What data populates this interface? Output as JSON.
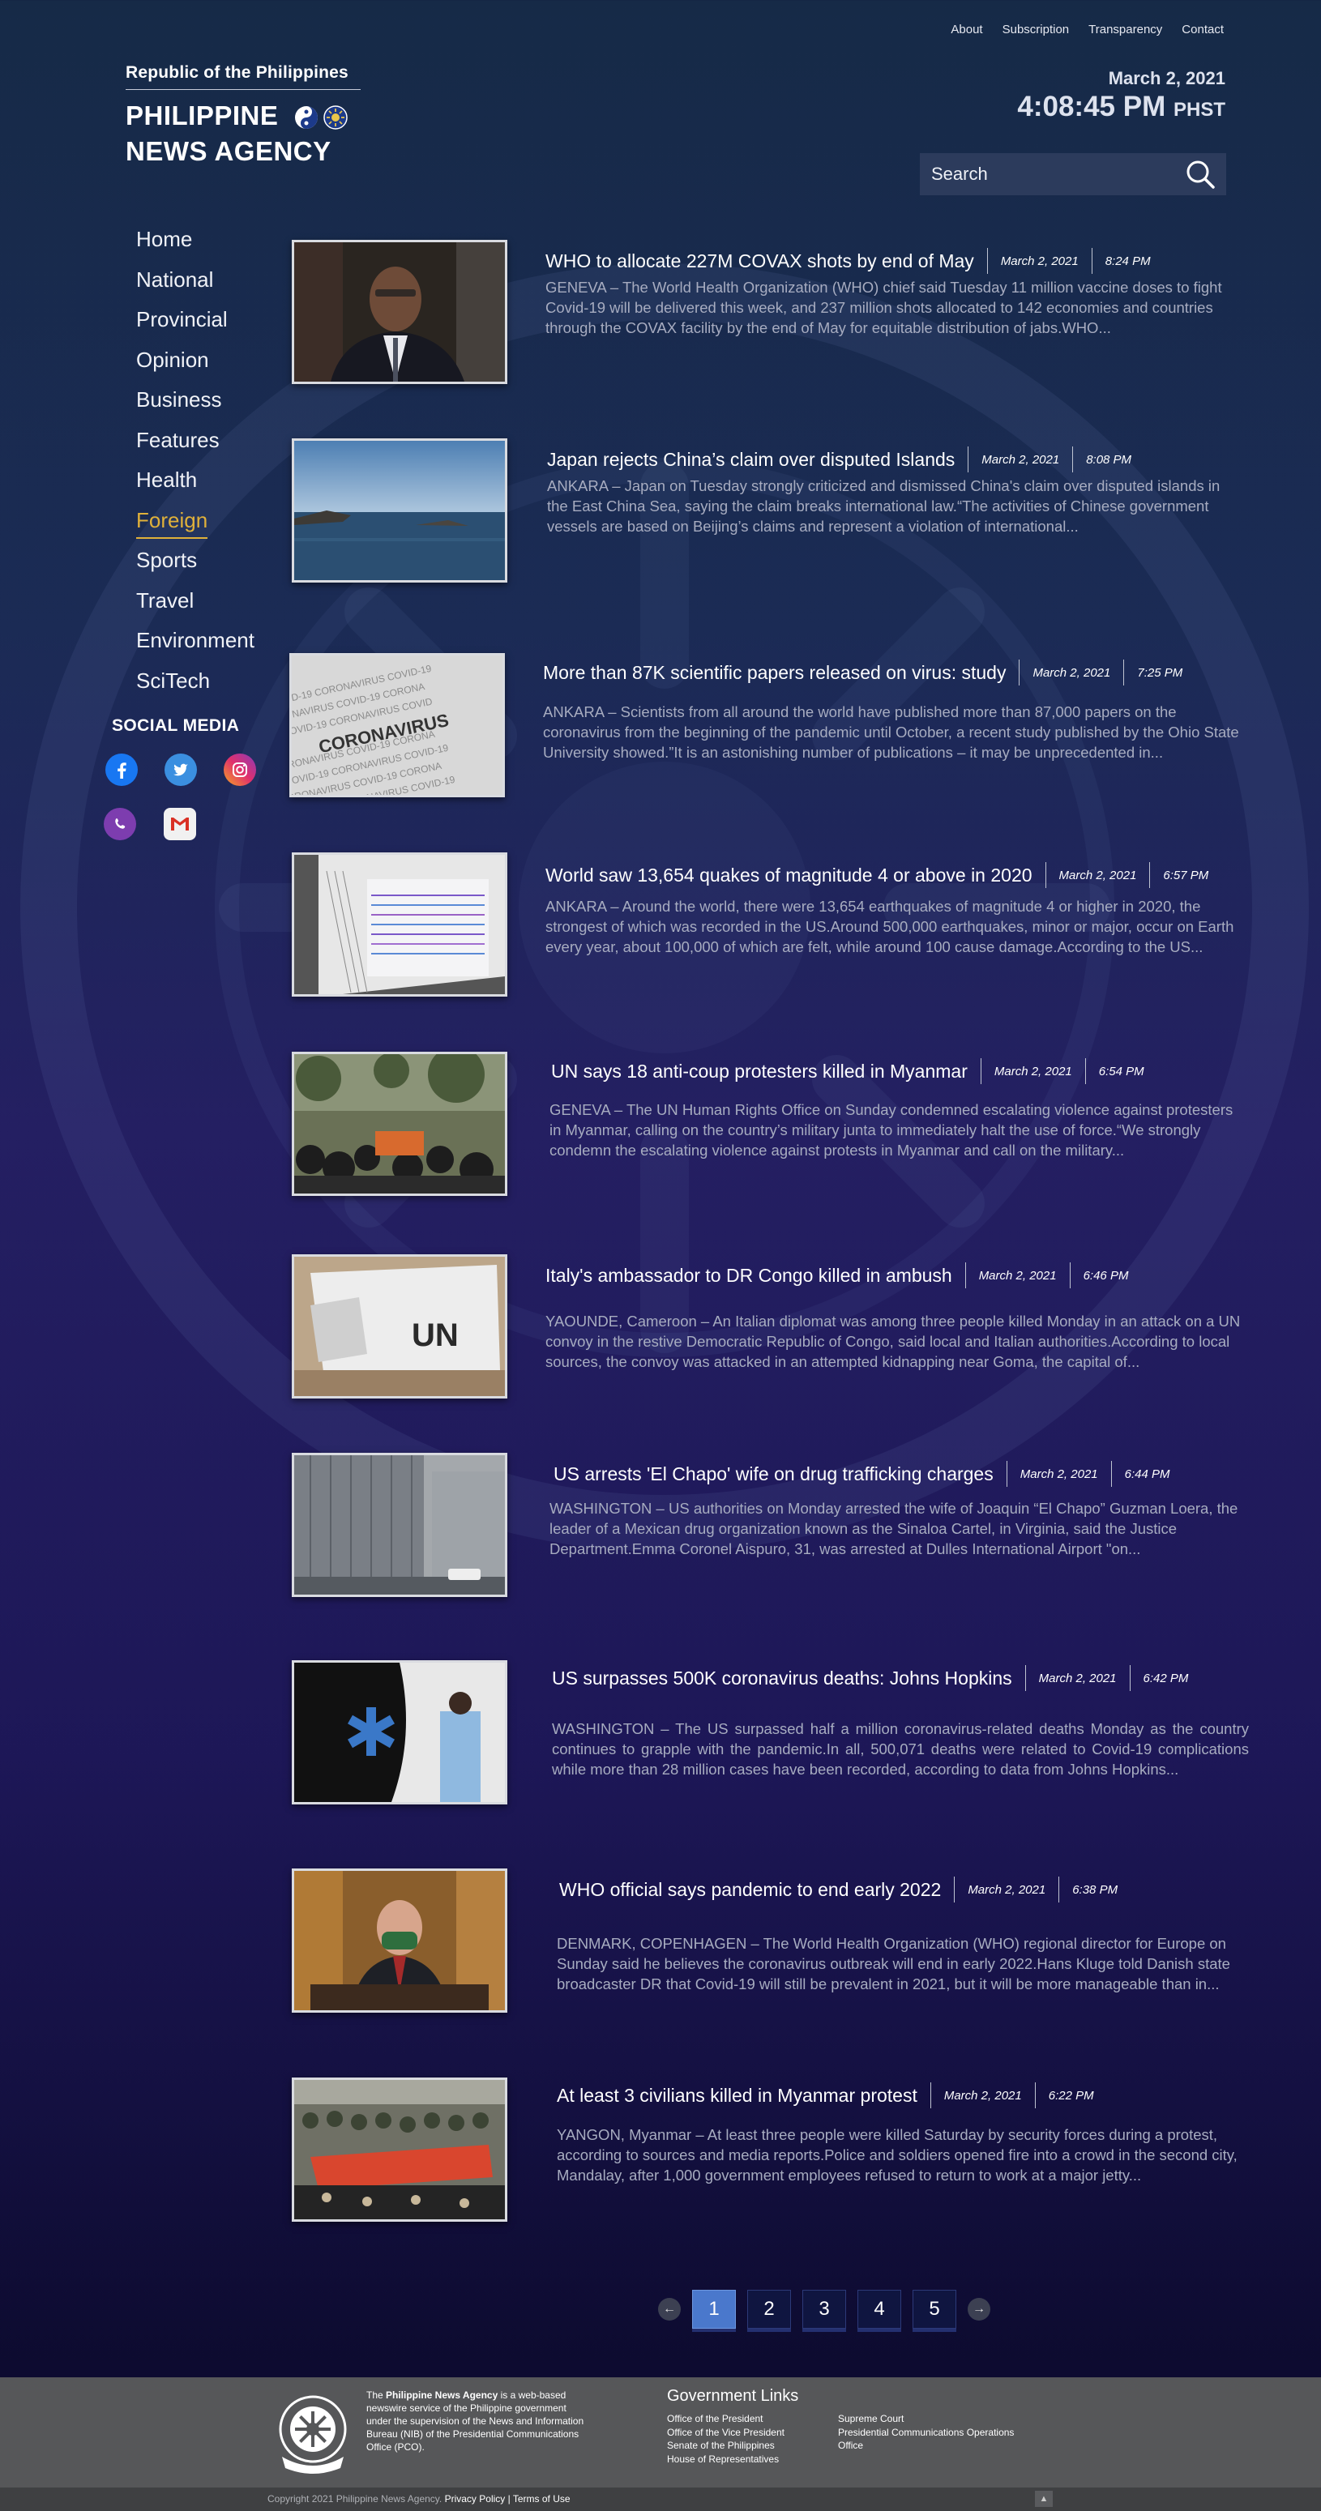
{
  "top_nav": [
    "About",
    "Subscription",
    "Transparency",
    "Contact"
  ],
  "brand": {
    "republic": "Republic of the Philippines",
    "name_line1": "PHILIPPINE",
    "name_line2": "NEWS AGENCY"
  },
  "clock": {
    "date": "March 2, 2021",
    "time": "4:08:45 PM",
    "timezone": "PHST"
  },
  "search": {
    "placeholder": "Search",
    "icon": "search-icon"
  },
  "side_nav": [
    {
      "label": "Home",
      "active": false
    },
    {
      "label": "National",
      "active": false
    },
    {
      "label": "Provincial",
      "active": false
    },
    {
      "label": "Opinion",
      "active": false
    },
    {
      "label": "Business",
      "active": false
    },
    {
      "label": "Features",
      "active": false
    },
    {
      "label": "Health",
      "active": false
    },
    {
      "label": "Foreign",
      "active": true
    },
    {
      "label": "Sports",
      "active": false
    },
    {
      "label": "Travel",
      "active": false
    },
    {
      "label": "Environment",
      "active": false
    },
    {
      "label": "SciTech",
      "active": false
    }
  ],
  "social": {
    "title": "SOCIAL MEDIA",
    "icons": [
      "facebook-icon",
      "twitter-icon",
      "instagram-icon",
      "viber-icon",
      "gmail-icon"
    ]
  },
  "articles": [
    {
      "title": "WHO to allocate 227M COVAX shots by end of May",
      "date": "March 2, 2021",
      "time": "8:24 PM",
      "excerpt": "GENEVA – The World Health Organization (WHO) chief said Tuesday 11 million vaccine doses to fight Covid-19 will be delivered this week, and 237 million shots allocated to 142 economies and countries through the COVAX facility by the end of May for equitable distribution of jabs.WHO..."
    },
    {
      "title": "Japan rejects China’s claim over disputed Islands",
      "date": "March 2, 2021",
      "time": "8:08 PM",
      "excerpt": "ANKARA – Japan on Tuesday strongly criticized and dismissed China's claim over disputed islands in the East China Sea, saying the claim breaks international law.“The activities of Chinese government vessels are based on Beijing’s claims and represent a violation of international..."
    },
    {
      "title": "More than 87K scientific papers released on virus: study",
      "date": "March 2, 2021",
      "time": "7:25 PM",
      "excerpt": "ANKARA – Scientists from all around the world have published more than 87,000 papers on the coronavirus from the beginning of the pandemic until October, a recent study published by the Ohio State University showed.”It is an astonishing number of publications – it may be unprecedented in..."
    },
    {
      "title": "World saw 13,654 quakes of magnitude 4 or above in 2020",
      "date": "March 2, 2021",
      "time": "6:57 PM",
      "excerpt": "ANKARA – Around the world, there were 13,654 earthquakes of magnitude 4 or higher in 2020, the strongest of which was recorded in the US.Around 500,000 earthquakes, minor or major, occur on Earth every year, about 100,000 of which are felt, while around 100 cause damage.According to the US..."
    },
    {
      "title": "UN says 18 anti-coup protesters killed in Myanmar",
      "date": "March 2, 2021",
      "time": "6:54 PM",
      "excerpt": "GENEVA – The UN Human Rights Office on Sunday condemned escalating violence against protesters in Myanmar, calling on the country’s military junta to immediately halt the use of force.“We strongly condemn the escalating violence against protests in Myanmar and call on the military..."
    },
    {
      "title": "Italy's ambassador to DR Congo killed in ambush",
      "date": "March 2, 2021",
      "time": "6:46 PM",
      "excerpt": "YAOUNDE, Cameroon – An Italian diplomat was among three people killed Monday in an attack on a UN convoy in the restive Democratic Republic of Congo, said local and Italian authorities.According to local sources, the convoy was attacked in an attempted kidnapping near Goma, the capital of..."
    },
    {
      "title": "US arrests 'El Chapo' wife on drug trafficking charges",
      "date": "March 2, 2021",
      "time": "6:44 PM",
      "excerpt": "WASHINGTON – US authorities on Monday arrested the wife of Joaquin “El Chapo” Guzman Loera, the leader of a Mexican drug organization known as the Sinaloa Cartel, in Virginia, said the Justice Department.Emma Coronel Aispuro, 31, was arrested at Dulles International Airport \"on..."
    },
    {
      "title": "US surpasses 500K coronavirus deaths: Johns Hopkins",
      "date": "March 2, 2021",
      "time": "6:42 PM",
      "excerpt": "WASHINGTON – The US surpassed half a million coronavirus-related deaths Monday as the country continues to grapple with the pandemic.In all, 500,071 deaths were related to Covid-19 complications while more than 28 million cases have been recorded, according to data from Johns Hopkins..."
    },
    {
      "title": "WHO official says pandemic to end early 2022",
      "date": "March 2, 2021",
      "time": "6:38 PM",
      "excerpt": "DENMARK, COPENHAGEN – The World Health Organization (WHO) regional director for Europe on Sunday said he believes the coronavirus outbreak will end in early 2022.Hans Kluge told Danish state broadcaster DR that Covid-19 will still be prevalent in 2021, but it will be more manageable than in..."
    },
    {
      "title": "At least 3 civilians killed in Myanmar protest",
      "date": "March 2, 2021",
      "time": "6:22 PM",
      "excerpt": "YANGON, Myanmar – At least three people were killed Saturday by security forces during a protest, according to sources and media reports.Police and soldiers opened fire into a crowd in the second city, Mandalay, after 1,000 government employees refused to return to work at a major jetty..."
    }
  ],
  "pagination": {
    "pages": [
      "1",
      "2",
      "3",
      "4",
      "5"
    ],
    "current": "1"
  },
  "footer": {
    "desc_prefix": "The ",
    "desc_bold": "Philippine News Agency",
    "desc_rest": " is a web-based newswire service of the Philippine government under the supervision of the News and Information Bureau (NIB) of the Presidential Communications Office (PCO).",
    "gov_title": "Government Links",
    "gov_links_col1": [
      "Office of the President",
      "Office of the Vice President",
      "Senate of the Philippines",
      "House of Representatives"
    ],
    "gov_links_col2": [
      "Supreme Court",
      "Presidential Communications Operations",
      "Office"
    ],
    "copyright": "Copyright 2021 Philippine News Agency.",
    "privacy": "Privacy Policy",
    "terms": "Terms of Use",
    "divider": "|"
  }
}
